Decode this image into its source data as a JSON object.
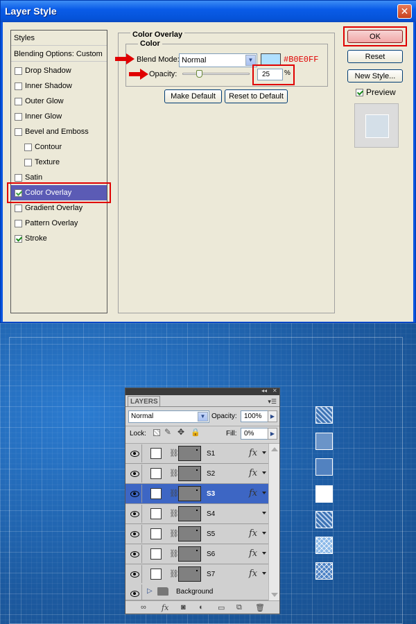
{
  "dialog": {
    "title": "Layer Style",
    "close_label": "✕",
    "styles_header": "Styles",
    "blending_options": "Blending Options: Custom",
    "styles": [
      {
        "label": "Drop Shadow",
        "checked": false
      },
      {
        "label": "Inner Shadow",
        "checked": false
      },
      {
        "label": "Outer Glow",
        "checked": false
      },
      {
        "label": "Inner Glow",
        "checked": false
      },
      {
        "label": "Bevel and Emboss",
        "checked": false
      },
      {
        "label": "Contour",
        "checked": false
      },
      {
        "label": "Texture",
        "checked": false
      },
      {
        "label": "Satin",
        "checked": false
      },
      {
        "label": "Color Overlay",
        "checked": true
      },
      {
        "label": "Gradient Overlay",
        "checked": false
      },
      {
        "label": "Pattern Overlay",
        "checked": false
      },
      {
        "label": "Stroke",
        "checked": true
      }
    ],
    "group_title": "Color Overlay",
    "subgroup_title": "Color",
    "blend_mode_label": "Blend Mode:",
    "blend_mode_value": "Normal",
    "overlay_color": "#b0e0ff",
    "overlay_color_hex": "#B0E0FF",
    "opacity_label": "Opacity:",
    "opacity_value": "25",
    "opacity_unit": "%",
    "opacity_fraction": 0.25,
    "make_default": "Make Default",
    "reset_to_default": "Reset to Default",
    "ok": "OK",
    "reset": "Reset",
    "new_style": "New Style...",
    "preview_label": "Preview",
    "preview_checked": true
  },
  "layers_panel": {
    "tab": "LAYERS",
    "blend_mode": "Normal",
    "opacity_label": "Opacity:",
    "opacity_value": "100%",
    "lock_label": "Lock:",
    "fill_label": "Fill:",
    "fill_value": "0%",
    "layers": [
      {
        "name": "S1",
        "fx": true,
        "selected": false
      },
      {
        "name": "S2",
        "fx": true,
        "selected": false
      },
      {
        "name": "S3",
        "fx": true,
        "selected": true
      },
      {
        "name": "S4",
        "fx": false,
        "selected": false
      },
      {
        "name": "S5",
        "fx": true,
        "selected": false
      },
      {
        "name": "S6",
        "fx": true,
        "selected": false
      },
      {
        "name": "S7",
        "fx": true,
        "selected": false
      }
    ],
    "background_group": "Background",
    "fx_label": "fx"
  },
  "colors": {
    "highlight_red": "#e00000",
    "selected_style": "#5b5bb5",
    "selected_layer": "#3d66c4"
  }
}
